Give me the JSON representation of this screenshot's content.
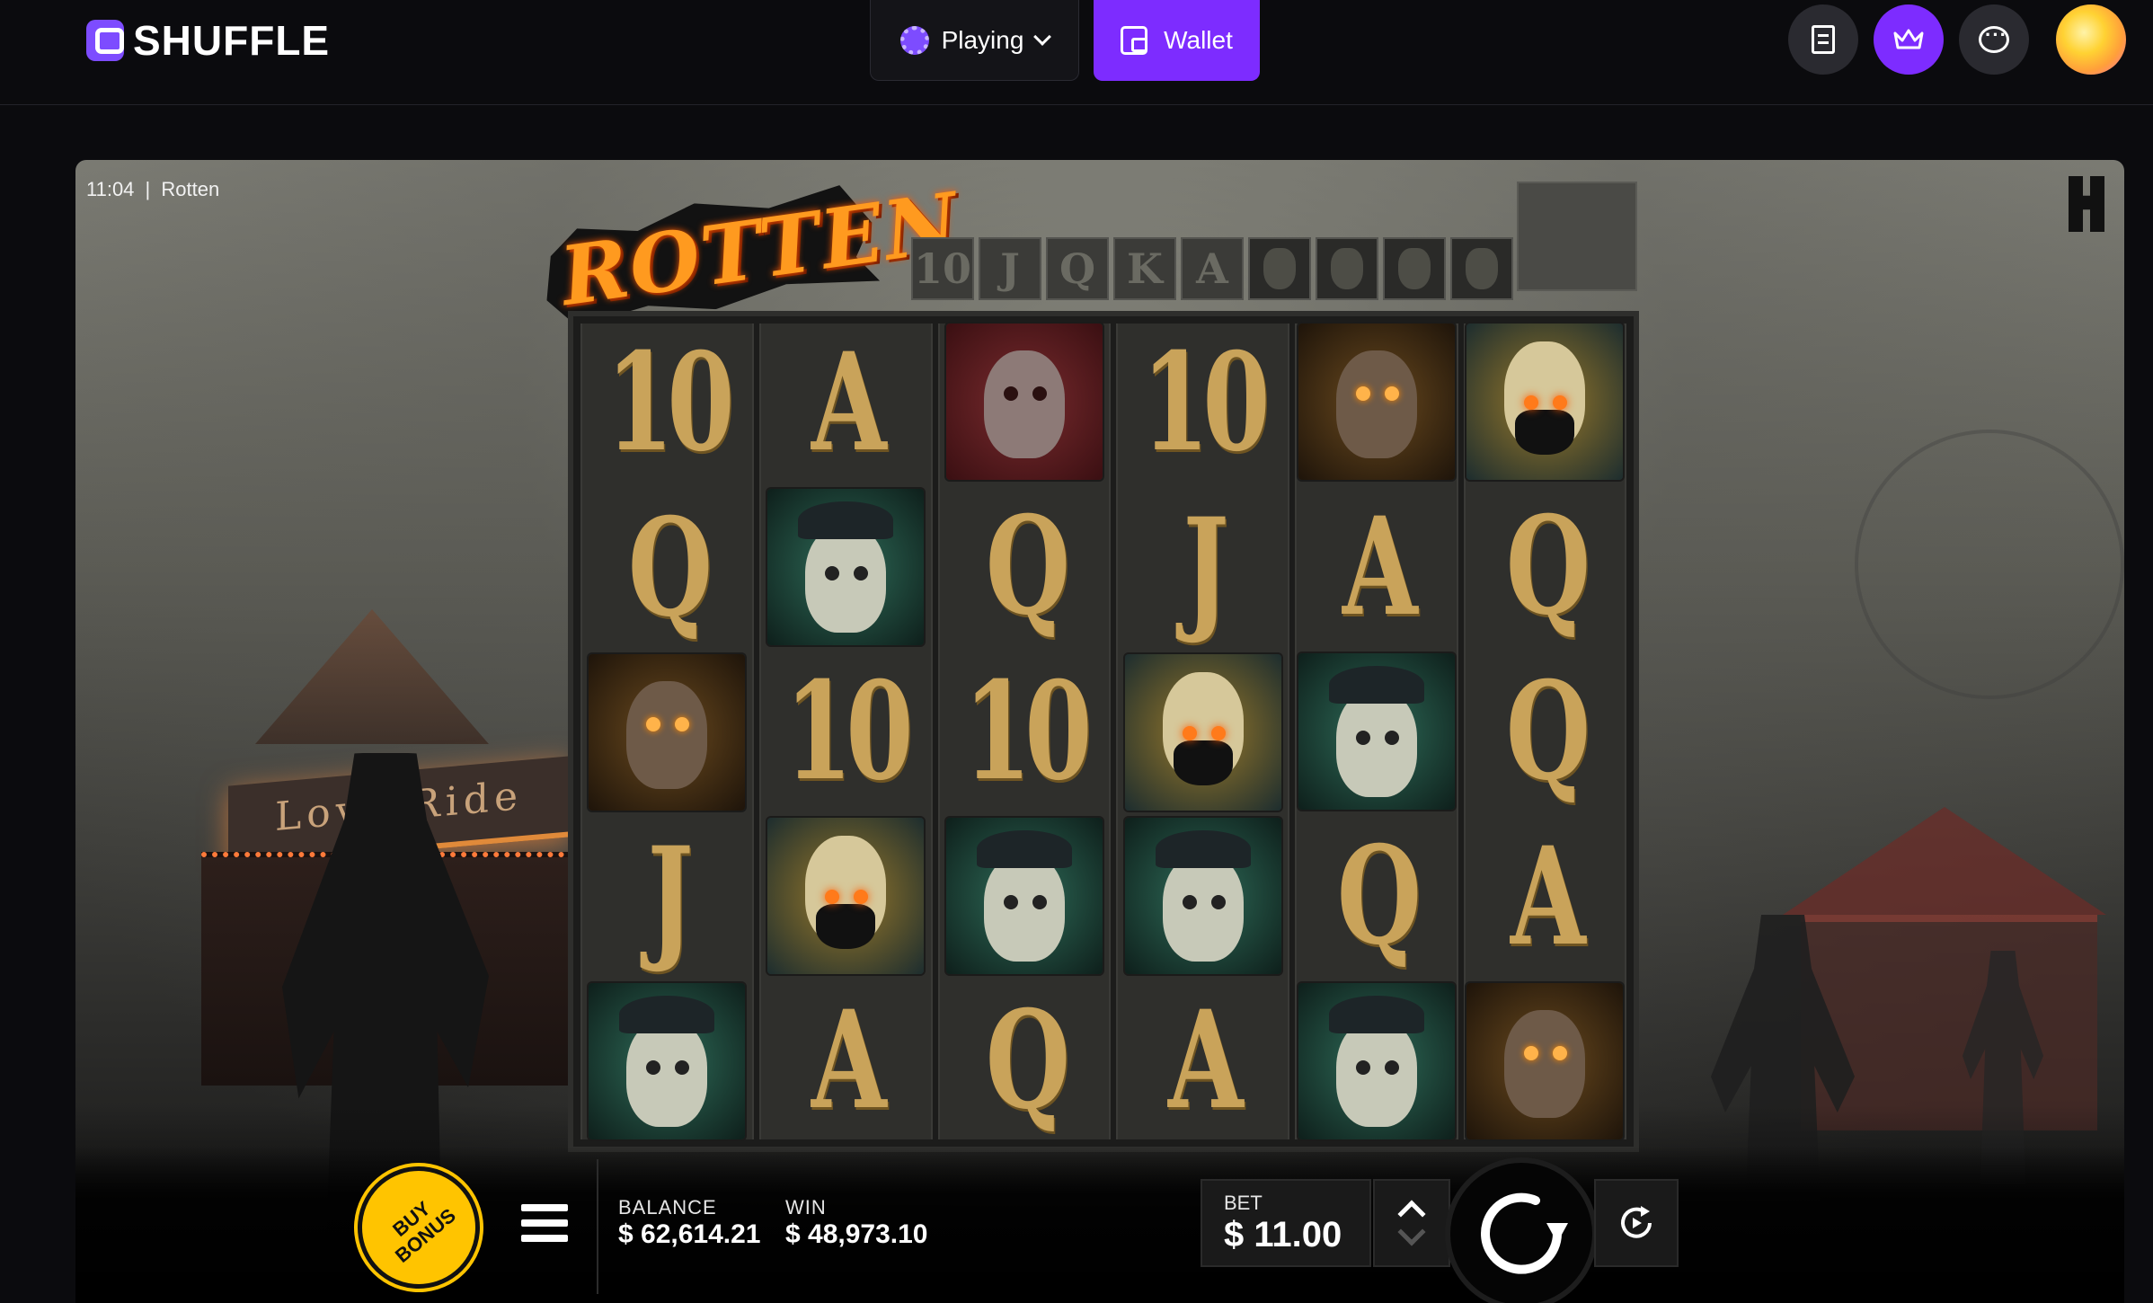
{
  "header": {
    "brand": "SHUFFLE",
    "playing_label": "Playing",
    "wallet_label": "Wallet",
    "accent": "#7d2cff"
  },
  "game": {
    "clock": "11:04",
    "separator": "|",
    "name": "Rotten",
    "title_art": "ROTTEN",
    "sign_text": "Love Ride",
    "paytable": [
      "10",
      "J",
      "Q",
      "K",
      "A"
    ],
    "reels": [
      [
        {
          "type": "letter",
          "value": "10"
        },
        {
          "type": "letter",
          "value": "Q"
        },
        {
          "type": "face",
          "value": "girl-zombie"
        },
        {
          "type": "letter",
          "value": "J"
        },
        {
          "type": "face",
          "value": "police-zombie"
        }
      ],
      [
        {
          "type": "letter",
          "value": "A"
        },
        {
          "type": "face",
          "value": "police-zombie"
        },
        {
          "type": "letter",
          "value": "10"
        },
        {
          "type": "face",
          "value": "gasmask-zombie"
        },
        {
          "type": "letter",
          "value": "A"
        }
      ],
      [
        {
          "type": "face",
          "value": "red-zombie"
        },
        {
          "type": "letter",
          "value": "Q"
        },
        {
          "type": "letter",
          "value": "10"
        },
        {
          "type": "face",
          "value": "police-zombie"
        },
        {
          "type": "letter",
          "value": "Q"
        }
      ],
      [
        {
          "type": "letter",
          "value": "10"
        },
        {
          "type": "letter",
          "value": "J"
        },
        {
          "type": "face",
          "value": "gasmask-zombie"
        },
        {
          "type": "face",
          "value": "police-zombie"
        },
        {
          "type": "letter",
          "value": "A"
        }
      ],
      [
        {
          "type": "face",
          "value": "girl-zombie"
        },
        {
          "type": "letter",
          "value": "A"
        },
        {
          "type": "face",
          "value": "police-zombie"
        },
        {
          "type": "letter",
          "value": "Q"
        },
        {
          "type": "face",
          "value": "police-zombie"
        }
      ],
      [
        {
          "type": "face",
          "value": "gasmask-zombie"
        },
        {
          "type": "letter",
          "value": "Q"
        },
        {
          "type": "letter",
          "value": "Q"
        },
        {
          "type": "letter",
          "value": "A"
        },
        {
          "type": "face",
          "value": "girl-zombie"
        }
      ]
    ],
    "buy_bonus": "BUY BONUS",
    "balance_label": "BALANCE",
    "balance_value": "$ 62,614.21",
    "win_label": "WIN",
    "win_value": "$ 48,973.10",
    "bet_label": "BET",
    "bet_value": "$ 11.00"
  }
}
